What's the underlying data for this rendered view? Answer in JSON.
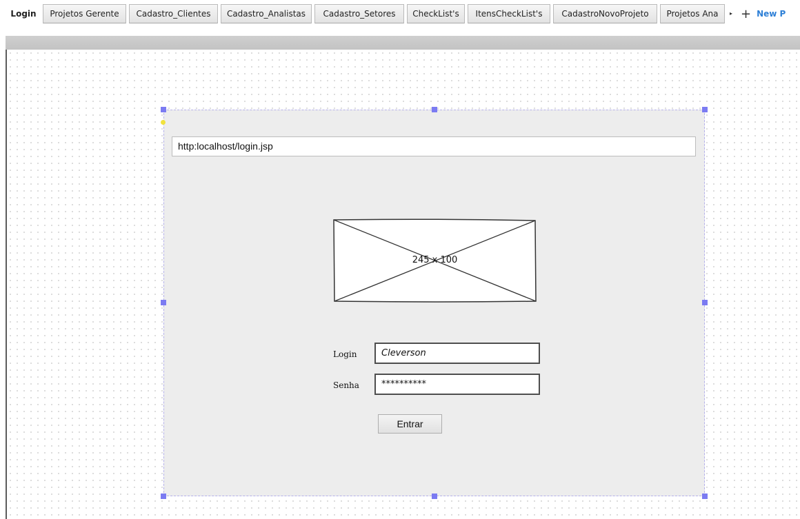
{
  "tabs": [
    {
      "label": "Login",
      "active": true
    },
    {
      "label": "Projetos Gerente",
      "active": false
    },
    {
      "label": "Cadastro_Clientes",
      "active": false
    },
    {
      "label": "Cadastro_Analistas",
      "active": false
    },
    {
      "label": "Cadastro_Setores",
      "active": false
    },
    {
      "label": "CheckList's",
      "active": false
    },
    {
      "label": "ItensCheckList's",
      "active": false
    },
    {
      "label": "CadastroNovoProjeto",
      "active": false
    },
    {
      "label": "Projetos Ana",
      "active": false
    }
  ],
  "tab_bar": {
    "overflow_icon": "chevron-right-icon",
    "add_icon": "plus-icon",
    "new_page_label": "New P"
  },
  "mockup": {
    "url_text": "http:localhost/login.jsp",
    "image_placeholder_label": "245 x 100",
    "login_label": "Login",
    "login_value": "Cleverson",
    "password_label": "Senha",
    "password_value": "**********",
    "submit_label": "Entrar"
  },
  "colors": {
    "selection_handle": "#7b7bf2",
    "link_blue": "#2d7fd6",
    "container_bg": "#ededed"
  }
}
